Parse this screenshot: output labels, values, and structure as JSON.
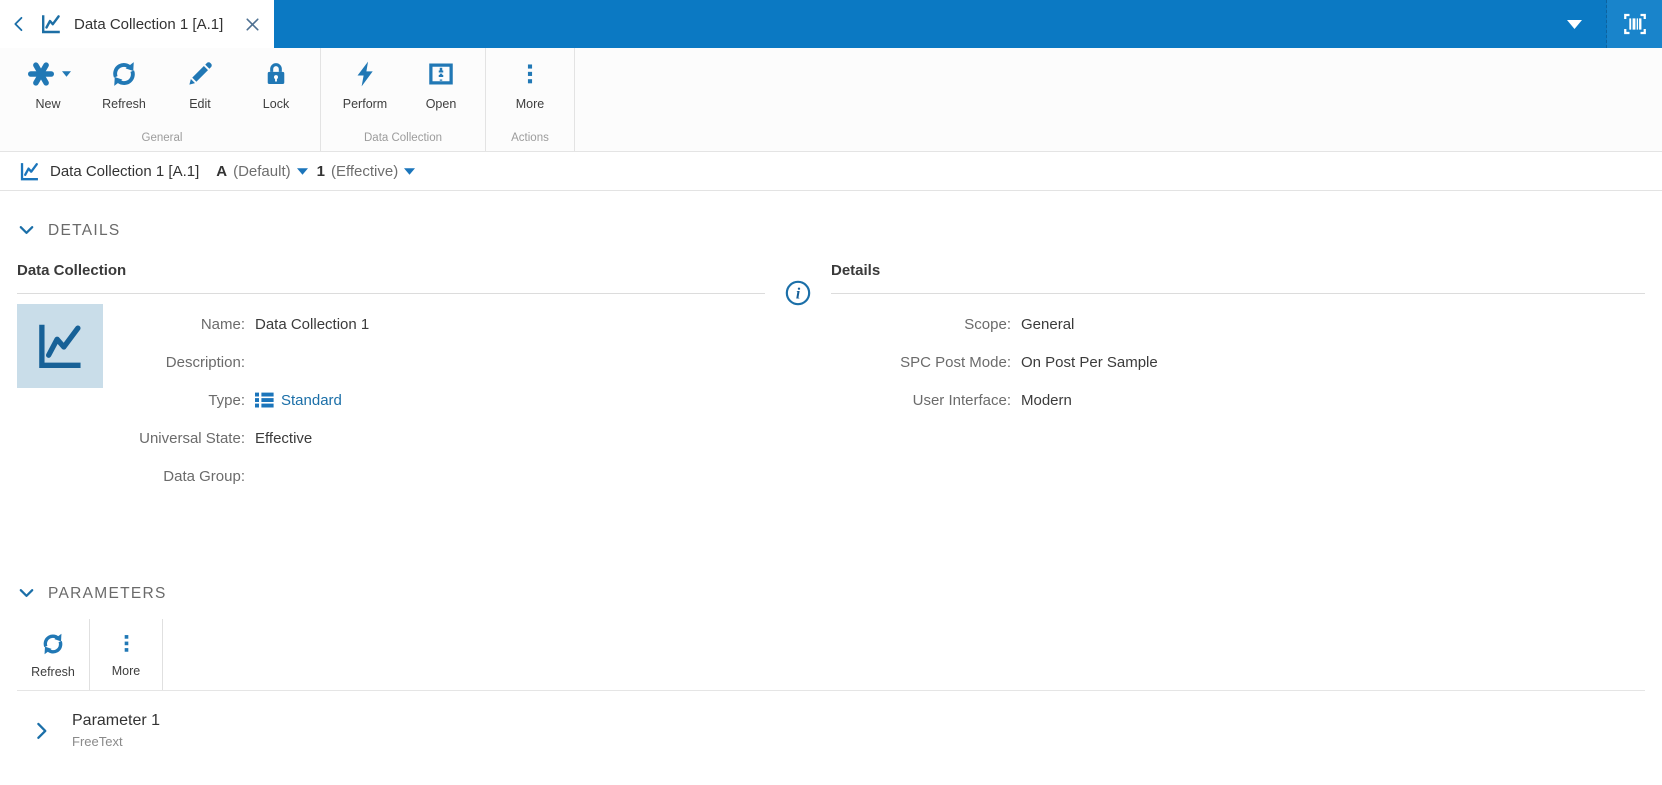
{
  "topbar": {
    "tab_title": "Data Collection 1 [A.1]"
  },
  "toolbar": {
    "groups": [
      {
        "label": "General",
        "buttons": [
          {
            "label": "New"
          },
          {
            "label": "Refresh"
          },
          {
            "label": "Edit"
          },
          {
            "label": "Lock"
          }
        ]
      },
      {
        "label": "Data Collection",
        "buttons": [
          {
            "label": "Perform"
          },
          {
            "label": "Open"
          }
        ]
      },
      {
        "label": "Actions",
        "buttons": [
          {
            "label": "More"
          }
        ]
      }
    ]
  },
  "breadcrumb": {
    "title": "Data Collection 1 [A.1]",
    "version": "A",
    "version_label": "(Default)",
    "revision": "1",
    "revision_label": "(Effective)"
  },
  "details": {
    "section_title": "DETAILS",
    "dc_panel": {
      "title": "Data Collection",
      "fields": [
        {
          "label": "Name:",
          "value": "Data Collection 1"
        },
        {
          "label": "Description:",
          "value": ""
        },
        {
          "label": "Type:",
          "value": "Standard"
        },
        {
          "label": "Universal State:",
          "value": "Effective"
        },
        {
          "label": "Data Group:",
          "value": ""
        }
      ]
    },
    "info_panel": {
      "title": "Details",
      "fields": [
        {
          "label": "Scope:",
          "value": "General"
        },
        {
          "label": "SPC Post Mode:",
          "value": "On Post Per Sample"
        },
        {
          "label": "User Interface:",
          "value": "Modern"
        }
      ]
    }
  },
  "parameters": {
    "section_title": "PARAMETERS",
    "toolbar": {
      "refresh_label": "Refresh",
      "more_label": "More"
    },
    "rows": [
      {
        "name": "Parameter 1",
        "type": "FreeText"
      }
    ]
  },
  "icons": {
    "new": "asterisk",
    "refresh": "circular-arrows",
    "edit": "pencil",
    "lock": "padlock",
    "perform": "lightning-bolt",
    "open": "split-panel",
    "more": "vertical-ellipsis",
    "entity": "line-chart",
    "type_standard": "list",
    "info": "circled-i",
    "scan": "barcode-scanner"
  },
  "colors": {
    "topbar_blue": "#0b79c3",
    "scan_area_blue": "#1984cb",
    "toolbar_icon_blue": "#2178b5",
    "link_blue": "#1b6fa8",
    "caret_blue": "#1b75bb",
    "label_gray": "#6b6b6b",
    "value_dark": "#3b3b3b",
    "thumbnail_bg": "#c9dde9",
    "thumbnail_icon": "#176197"
  }
}
